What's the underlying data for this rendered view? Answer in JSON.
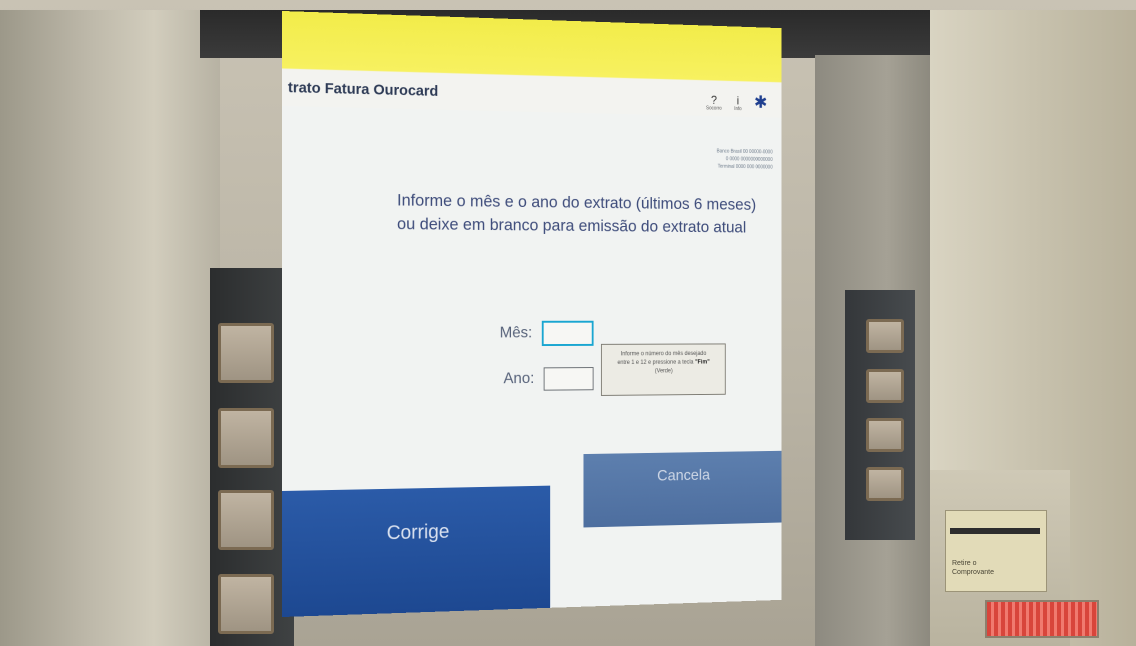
{
  "screen": {
    "title": "trato Fatura Ourocard",
    "header_icons": [
      {
        "name": "help-icon",
        "glyph": "?",
        "label": "Socorro"
      },
      {
        "name": "info-icon",
        "glyph": "i",
        "label": "Info"
      }
    ],
    "logo_glyph": "✱",
    "info_lines": [
      "Banco Brasil 00 00000-0000",
      "0 0000 0000000000000",
      "Terminal 0000 000 0000000"
    ],
    "prompt_line1": "Informe o mês e o ano do extrato (últimos 6 meses)",
    "prompt_line2": "ou deixe em branco para emissão do extrato atual",
    "month_label": "Mês:",
    "month_value": "",
    "year_label": "Ano:",
    "year_value": "",
    "hint_line1": "Informe o número do mês desejado",
    "hint_line2_pre": "entre 1 e 12 e pressione a tecla",
    "hint_key": "\"Fim\"",
    "hint_line3": "(Verde)",
    "corrige_label": "Corrige",
    "cancela_label": "Cancela"
  },
  "receipt": {
    "label": "Retire o Comprovante"
  },
  "colors": {
    "header_yellow": "#f2ec4a",
    "title_navy": "#2d3a55",
    "corrige_blue": "#1d4891",
    "cancela_blue": "#4d6e9f",
    "active_field": "#1aa6d1"
  }
}
